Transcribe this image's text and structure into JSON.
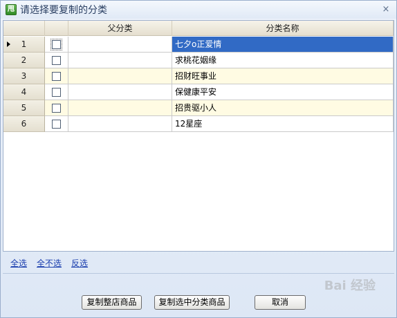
{
  "window": {
    "icon_glyph": "甩",
    "title": "请选择要复制的分类",
    "close_glyph": "×"
  },
  "grid": {
    "columns": {
      "parent": "父分类",
      "name": "分类名称"
    },
    "rows": [
      {
        "num": "1",
        "parent": "",
        "name": "七夕o正爱情",
        "checked": false,
        "selected": true
      },
      {
        "num": "2",
        "parent": "",
        "name": "求桃花姻缘",
        "checked": false,
        "selected": false
      },
      {
        "num": "3",
        "parent": "",
        "name": "招财旺事业",
        "checked": false,
        "selected": false
      },
      {
        "num": "4",
        "parent": "",
        "name": "保健康平安",
        "checked": false,
        "selected": false
      },
      {
        "num": "5",
        "parent": "",
        "name": "招贵驱小人",
        "checked": false,
        "selected": false
      },
      {
        "num": "6",
        "parent": "",
        "name": "12星座",
        "checked": false,
        "selected": false
      }
    ]
  },
  "links": {
    "select_all": "全选",
    "select_none": "全不选",
    "invert": "反选"
  },
  "buttons": {
    "copy_whole_store": "复制整店商品",
    "copy_selected": "复制选中分类商品",
    "cancel": "取消"
  },
  "watermark": "Bai 经验",
  "colors": {
    "selected_row": "#316ac5",
    "alt_row": "#fffbe3",
    "link": "#1b3fae"
  }
}
